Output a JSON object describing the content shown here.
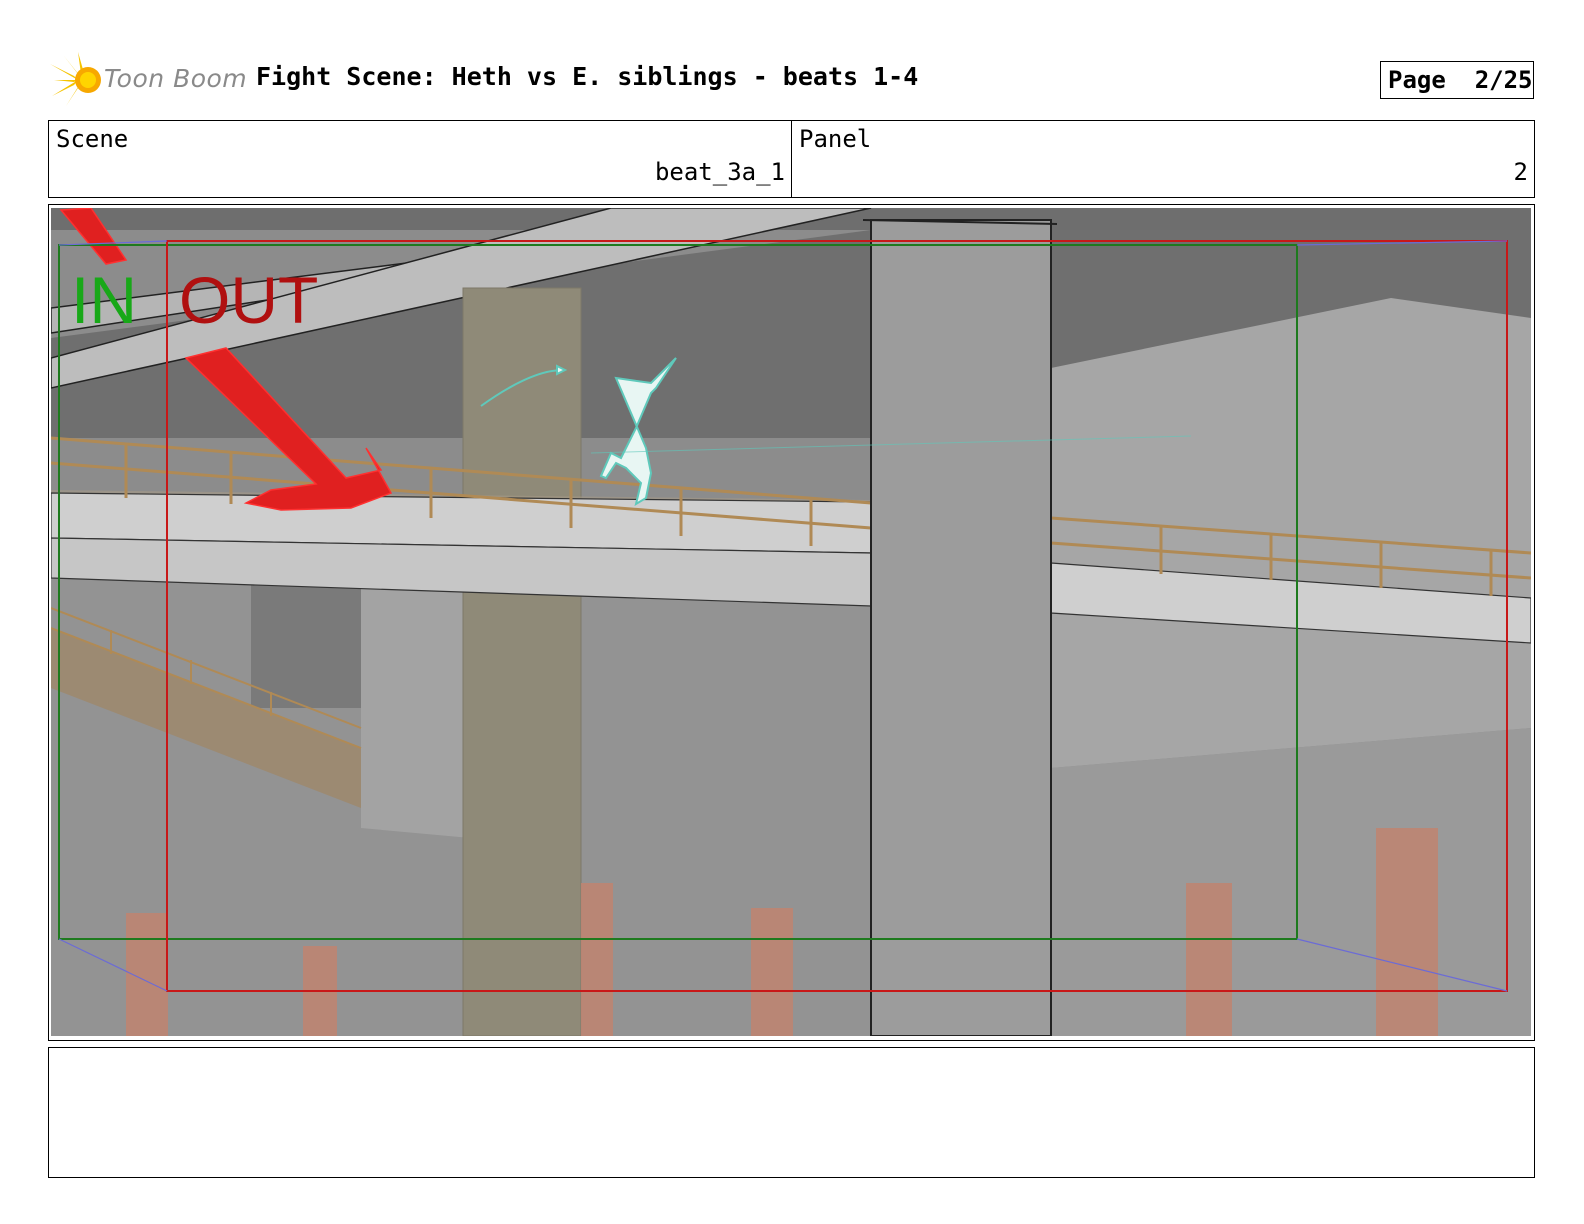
{
  "header": {
    "logo_text": "Toon Boom",
    "title": "Fight Scene: Heth vs E. siblings - beats 1-4",
    "page_label": "Page",
    "page_value": "2/25"
  },
  "info": {
    "scene_label": "Scene",
    "scene_value": "beat_3a_1",
    "panel_label": "Panel",
    "panel_value": "2"
  },
  "panel": {
    "in_label": "IN",
    "out_label": "OUT",
    "in_color": "#1a9e1a",
    "out_color": "#b01010"
  },
  "notes": {
    "text": ""
  }
}
